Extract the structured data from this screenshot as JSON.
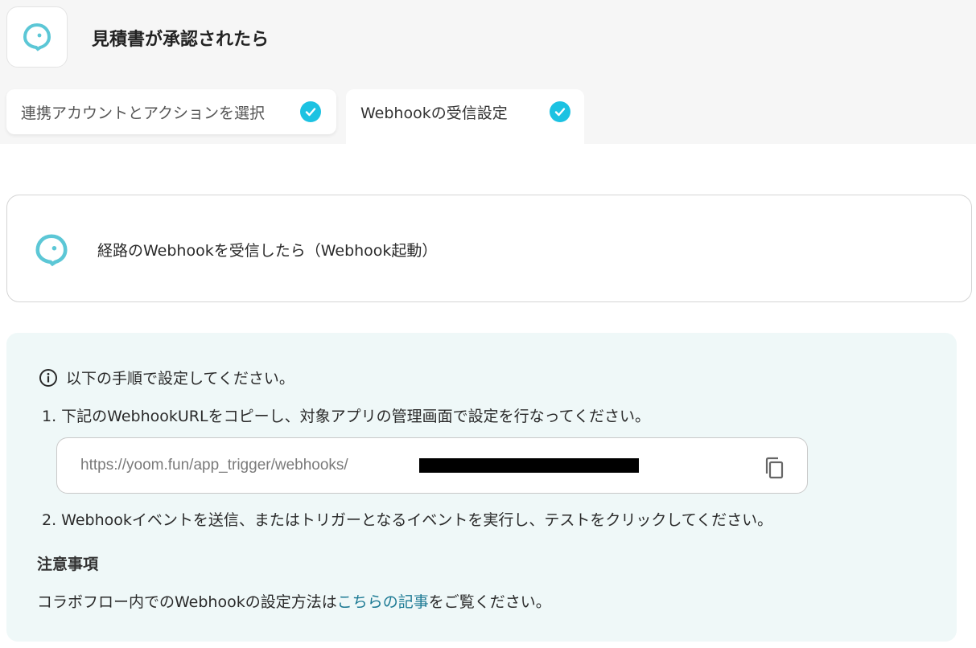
{
  "header": {
    "title": "見積書が承認されたら",
    "app_icon": "yoom-face-icon"
  },
  "tabs": [
    {
      "label": "連携アカウントとアクションを選択",
      "status": "complete",
      "active": false
    },
    {
      "label": "Webhookの受信設定",
      "status": "complete",
      "active": true
    }
  ],
  "trigger": {
    "label": "経路のWebhookを受信したら（Webhook起動）",
    "icon": "yoom-face-icon"
  },
  "instructions": {
    "heading": "以下の手順で設定してください。",
    "step1": "1. 下記のWebhookURLをコピーし、対象アプリの管理画面で設定を行なってください。",
    "webhook_url": "https://yoom.fun/app_trigger/webhooks/",
    "step2": "2. Webhookイベントを送信、またはトリガーとなるイベントを実行し、テストをクリックしてください。"
  },
  "notes": {
    "title": "注意事項",
    "text_before": "コラボフロー内でのWebhookの設定方法は",
    "link_text": "こちらの記事",
    "text_after": "をご覧ください。"
  },
  "colors": {
    "accent": "#1cc2e2",
    "link": "#1d7a94",
    "panel_bg": "#eff8f8"
  }
}
